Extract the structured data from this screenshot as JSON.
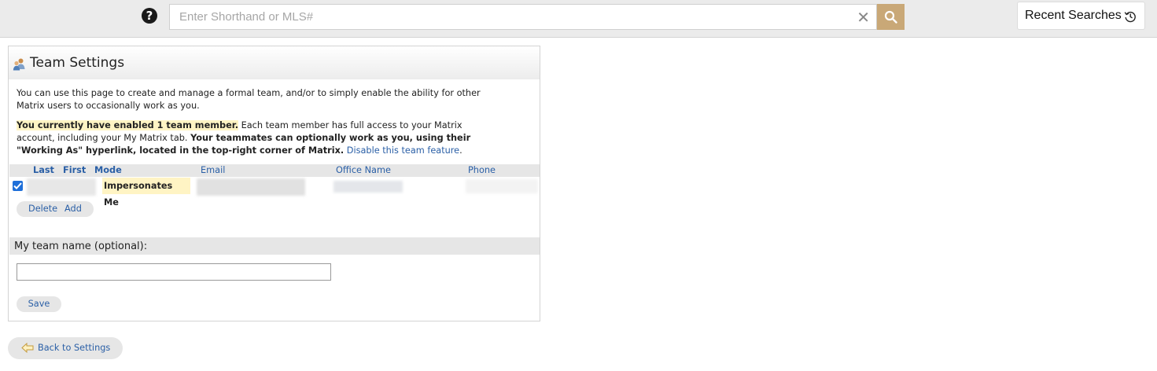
{
  "topbar": {
    "help_icon": "question-circle-icon",
    "search_placeholder": "Enter Shorthand or MLS#",
    "search_value": "",
    "clear_icon": "x-icon",
    "search_button_icon": "search-icon",
    "recent_searches_label": "Recent Searches",
    "recent_icon": "history-icon",
    "accent_color": "#c9a877"
  },
  "panel": {
    "title": "Team Settings",
    "title_icon": "team-icon",
    "intro": "You can use this page to create and manage a formal team, and/or to simply enable the ability for other Matrix users to occasionally work as you.",
    "enabled_highlight": "You currently have enabled 1 team member.",
    "access_text": " Each team member has full access to your Matrix account, including your My Matrix tab. ",
    "working_as_text": "Your teammates can optionally work as you, using their \"Working As\" hyperlink, located in the top-right corner of Matrix.",
    "disable_link": "Disable this team feature",
    "period": "."
  },
  "grid": {
    "columns": [
      "Last",
      "First",
      "Mode",
      "Email",
      "Office Name",
      "Phone"
    ],
    "rows": [
      {
        "checked": true,
        "last": "",
        "first": "",
        "mode": "Impersonates Me",
        "email": "",
        "office_name": "",
        "phone": ""
      }
    ],
    "delete_label": "Delete",
    "add_label": "Add"
  },
  "team_name": {
    "label": "My team name (optional):",
    "value": "",
    "save_label": "Save"
  },
  "footer": {
    "back_label": "Back to Settings",
    "back_icon": "arrow-left-icon"
  }
}
